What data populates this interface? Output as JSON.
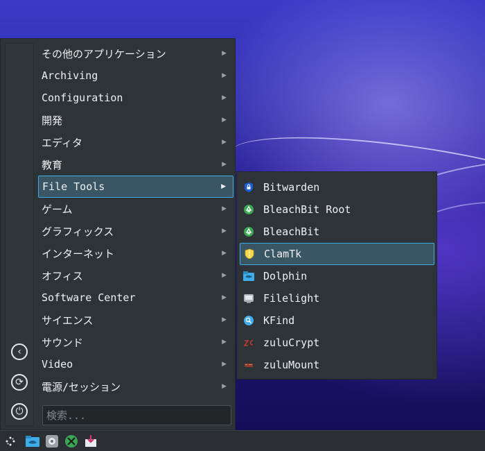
{
  "menu": {
    "items": [
      {
        "label": "その他のアプリケーション",
        "active": false
      },
      {
        "label": "Archiving",
        "active": false
      },
      {
        "label": "Configuration",
        "active": false
      },
      {
        "label": "開発",
        "active": false
      },
      {
        "label": "エディタ",
        "active": false
      },
      {
        "label": "教育",
        "active": false
      },
      {
        "label": "File Tools",
        "active": true
      },
      {
        "label": "ゲーム",
        "active": false
      },
      {
        "label": "グラフィックス",
        "active": false
      },
      {
        "label": "インターネット",
        "active": false
      },
      {
        "label": "オフィス",
        "active": false
      },
      {
        "label": "Software Center",
        "active": false
      },
      {
        "label": "サイエンス",
        "active": false
      },
      {
        "label": "サウンド",
        "active": false
      },
      {
        "label": "Video",
        "active": false
      },
      {
        "label": "電源/セッション",
        "active": false
      }
    ],
    "search_placeholder": "検索...",
    "rail_buttons": [
      {
        "icon": "back-arrow-icon",
        "glyph": "‹"
      },
      {
        "icon": "refresh-icon",
        "glyph": "⟳"
      },
      {
        "icon": "power-icon",
        "glyph": "⏻"
      }
    ]
  },
  "submenu": {
    "items": [
      {
        "label": "Bitwarden",
        "icon": "bitwarden-icon",
        "color": "#175ddc",
        "active": false
      },
      {
        "label": "BleachBit Root",
        "icon": "bleachbit-root-icon",
        "color": "#3aa852",
        "active": false
      },
      {
        "label": "BleachBit",
        "icon": "bleachbit-icon",
        "color": "#3aa852",
        "active": false
      },
      {
        "label": "ClamTk",
        "icon": "clamtk-shield-icon",
        "color": "#f2d94e",
        "active": true
      },
      {
        "label": "Dolphin",
        "icon": "dolphin-folder-icon",
        "color": "#3daee9",
        "active": false
      },
      {
        "label": "Filelight",
        "icon": "filelight-icon",
        "color": "#b0b6bb",
        "active": false
      },
      {
        "label": "KFind",
        "icon": "kfind-search-icon",
        "color": "#3daee9",
        "active": false
      },
      {
        "label": "zuluCrypt",
        "icon": "zulucrypt-icon",
        "color": "#c0392b",
        "active": false
      },
      {
        "label": "zuluMount",
        "icon": "zulumount-icon",
        "color": "#8e3b2e",
        "active": false
      }
    ]
  },
  "taskbar": {
    "icons": [
      "app-launcher-icon",
      "dolphin-taskbar-icon",
      "settings-taskbar-icon",
      "xbox-taskbar-icon",
      "installer-taskbar-icon"
    ]
  },
  "colors": {
    "accent": "#3daee9",
    "panel": "#2e3338",
    "active_bg": "#3a5563"
  }
}
